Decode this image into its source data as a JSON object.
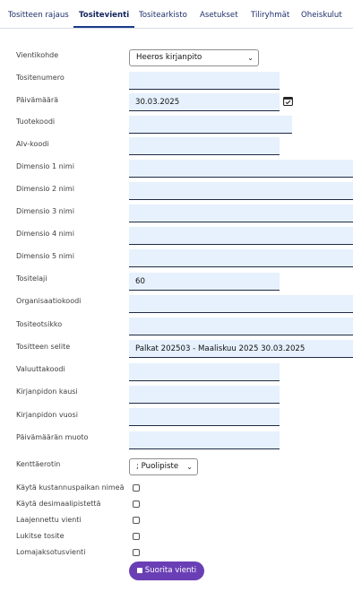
{
  "tabs": [
    "Tositteen rajaus",
    "Tositevienti",
    "Tositearkisto",
    "Asetukset",
    "Tiliryhmät",
    "Oheiskulut"
  ],
  "form": {
    "vientikohde": {
      "label": "Vientikohde",
      "value": "Heeros kirjanpito"
    },
    "tositenumero": {
      "label": "Tositenumero",
      "value": ""
    },
    "paivamaara": {
      "label": "Päivämäärä",
      "value": "30.03.2025"
    },
    "tuotekoodi": {
      "label": "Tuotekoodi",
      "value": ""
    },
    "alv": {
      "label": "Alv-koodi",
      "value": ""
    },
    "dim1": {
      "label": "Dimensio 1 nimi",
      "value": ""
    },
    "dim2": {
      "label": "Dimensio 2 nimi",
      "value": ""
    },
    "dim3": {
      "label": "Dimensio 3 nimi",
      "value": ""
    },
    "dim4": {
      "label": "Dimensio 4 nimi",
      "value": ""
    },
    "dim5": {
      "label": "Dimensio 5 nimi",
      "value": ""
    },
    "tositelaji": {
      "label": "Tositelaji",
      "value": "60"
    },
    "organisaatio": {
      "label": "Organisaatiokoodi",
      "value": ""
    },
    "otsikko": {
      "label": "Tositeotsikko",
      "value": ""
    },
    "selite": {
      "label": "Tositteen selite",
      "value": "Palkat 202503 - Maaliskuu 2025 30.03.2025"
    },
    "valuutta": {
      "label": "Valuuttakoodi",
      "value": ""
    },
    "kausi": {
      "label": "Kirjanpidon kausi",
      "value": ""
    },
    "vuosi": {
      "label": "Kirjanpidon vuosi",
      "value": ""
    },
    "muoto": {
      "label": "Päivämäärän muoto",
      "value": ""
    },
    "kenttaerotin": {
      "label": "Kenttäerotin",
      "value": "; Puolipiste"
    }
  },
  "checkboxes": [
    {
      "label": "Käytä kustannuspaikan nimeä",
      "checked": false
    },
    {
      "label": "Käytä desimaalipistettä",
      "checked": false
    },
    {
      "label": "Laajennettu vienti",
      "checked": false
    },
    {
      "label": "Lukitse tosite",
      "checked": false
    },
    {
      "label": "Lomajaksotusvienti",
      "checked": false
    }
  ],
  "run_button": "Suorita vienti",
  "colors": {
    "accent": "#6a3fb5",
    "field_bg": "#e6f1fd",
    "tab_text": "#1d2f6b"
  }
}
